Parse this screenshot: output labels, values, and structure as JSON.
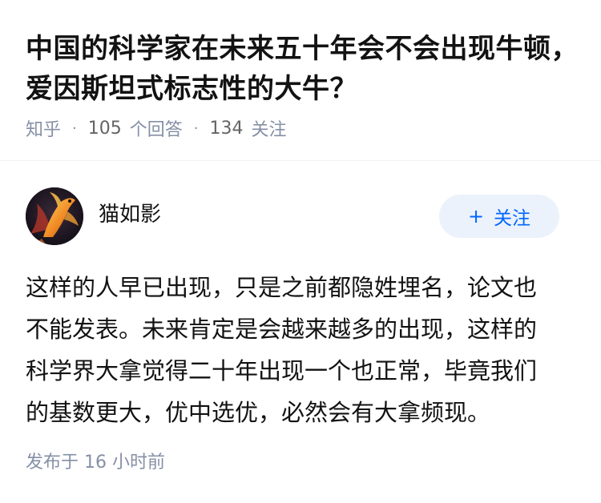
{
  "question": {
    "title": "中国的科学家在未来五十年会不会出现牛顿，爱因斯坦式标志性的大牛？",
    "source": "知乎",
    "answer_count": "105",
    "answer_label": "个回答",
    "follower_count": "134",
    "follower_label": "关注",
    "separator": "·"
  },
  "answer": {
    "author": {
      "name": "猫如影",
      "avatar_icon": "goldfish-avatar-icon"
    },
    "follow_button": {
      "plus": "+",
      "label": "关注"
    },
    "lines": [
      "这样的人早已出现，只是之前都隐姓埋名，论文也",
      "不能发表。未来肯定是会越来越多的出现，这样的",
      "科学界大拿觉得二十年出现一个也正常，毕竟我们",
      "的基数更大，优中选优，必然会有大拿频现。"
    ],
    "publish_time": "发布于  16 小时前"
  },
  "colors": {
    "accent": "#0066ff",
    "follow_bg": "#ebf2fb",
    "meta_text": "#8590a6",
    "main_text": "#121212"
  }
}
